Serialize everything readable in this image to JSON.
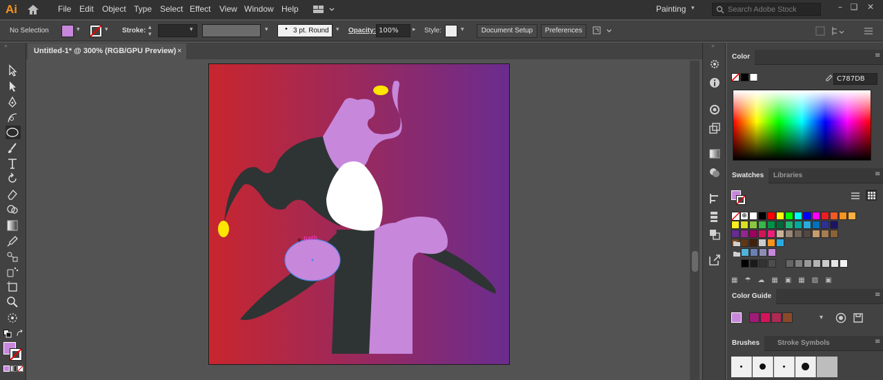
{
  "app": {
    "logo": "Ai"
  },
  "menu": [
    "File",
    "Edit",
    "Object",
    "Type",
    "Select",
    "Effect",
    "View",
    "Window",
    "Help"
  ],
  "workspace": "Painting",
  "search_placeholder": "Search Adobe Stock",
  "control": {
    "selection": "No Selection",
    "stroke_label": "Stroke:",
    "brush": "3 pt. Round",
    "opacity_label": "Opacity:",
    "opacity": "100%",
    "style_label": "Style:",
    "document_setup": "Document Setup",
    "preferences": "Preferences"
  },
  "tab": {
    "title": "Untitled-1* @ 300% (RGB/GPU Preview)",
    "close": "×"
  },
  "canvas": {
    "hover_label": "path"
  },
  "color_panel": {
    "title": "Color",
    "hex": "C787DB"
  },
  "swatches_panel": {
    "tabs": [
      "Swatches",
      "Libraries"
    ]
  },
  "color_guide": {
    "title": "Color Guide"
  },
  "brushes_panel": {
    "tabs": [
      "Brushes",
      "Stroke",
      "Symbols"
    ]
  },
  "colors": {
    "fill": "#c787db",
    "dark_figure": "#2e3434",
    "yellow": "#ffe600",
    "gradient_left": "#c8262e",
    "gradient_right": "#6a2c8f",
    "selection": "#4a86e8"
  },
  "swatch_rows": [
    [
      "#ffffff",
      "#000000",
      "#ff0000",
      "#ffff00",
      "#00ff00",
      "#00ffff",
      "#0000ff",
      "#ff00ff",
      "#ed1c24",
      "#f15a24",
      "#f7931e",
      "#fbb03b"
    ],
    [
      "#fcee21",
      "#d9e021",
      "#8cc63f",
      "#39b54a",
      "#009245",
      "#006837",
      "#22b573",
      "#00a99d",
      "#29abe2",
      "#0071bc",
      "#2e3192",
      "#1b1464"
    ],
    [
      "#662d91",
      "#93278f",
      "#9e005d",
      "#d4145a",
      "#ed1e79",
      "#c7b299",
      "#998675",
      "#736357",
      "#534741",
      "#c69c6d",
      "#a67c52",
      "#8c6239"
    ],
    [
      "#754c24",
      "#603813",
      "#42210b",
      "#cccccc",
      "#f7931e",
      "#29abe2"
    ]
  ],
  "swatch_group1": [
    "#4fb3d9",
    "#6b7fb3",
    "#8d8db5",
    "#c787db"
  ],
  "swatch_group2": [
    "#000000",
    "#1a1a1a",
    "#333333",
    "#4d4d4d",
    "#666666",
    "#808080",
    "#999999",
    "#b3b3b3",
    "#cccccc",
    "#e6e6e6",
    "#f2f2f2"
  ],
  "color_guide_swatches": [
    "#c787db",
    "#9e1b77",
    "#d4145a",
    "#ad2a52",
    "#8a4a2a"
  ]
}
